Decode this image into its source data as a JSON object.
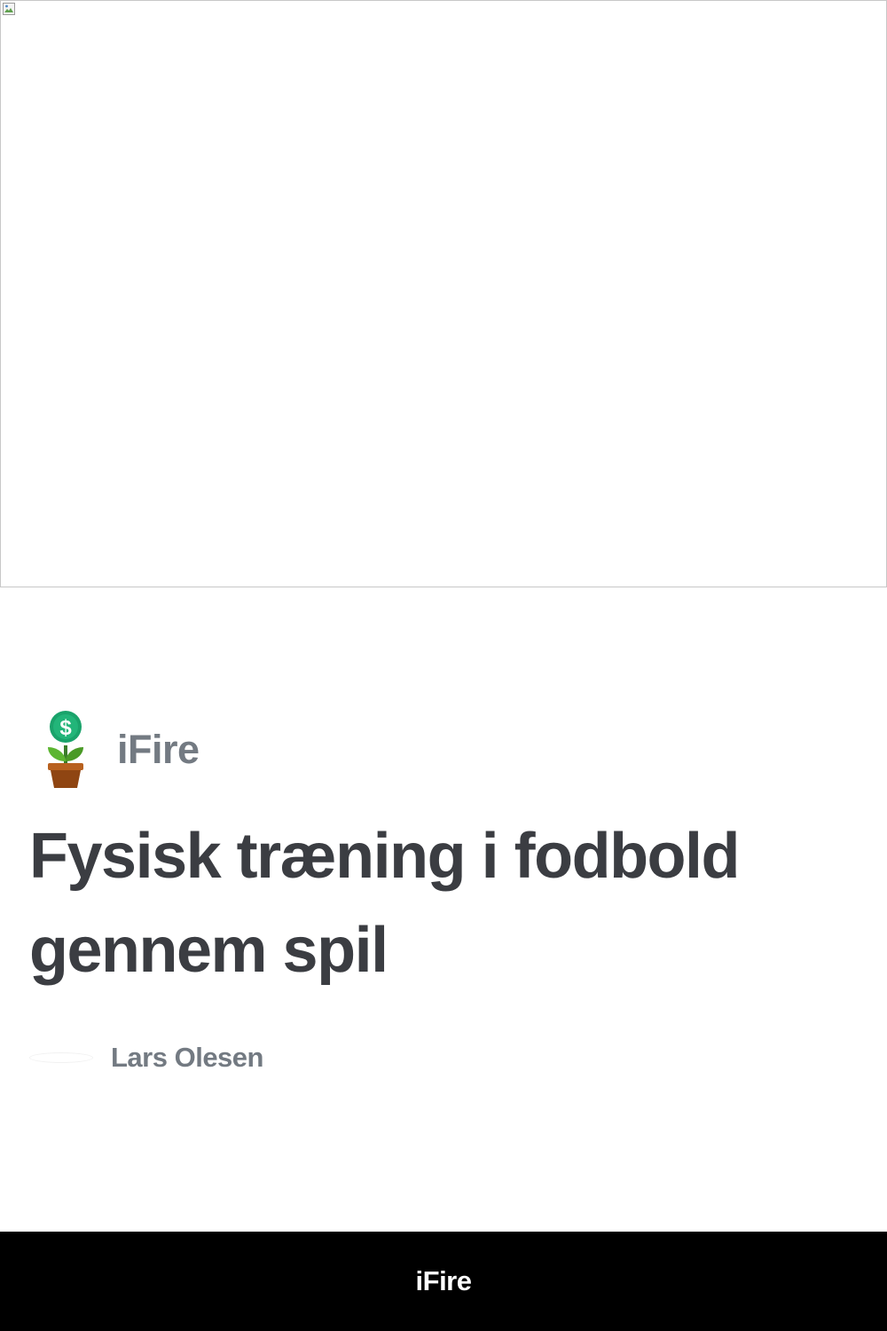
{
  "hero": {
    "icon": "broken-image-icon"
  },
  "brand": {
    "logo_icon": "money-plant-icon",
    "name": "iFire"
  },
  "story": {
    "title": "Fysisk træning i fodbold gennem spil"
  },
  "author": {
    "name": "Lars Olesen"
  },
  "footer": {
    "label": "iFire"
  },
  "colors": {
    "title_text": "#3b3d42",
    "muted_text": "#737a82",
    "footer_background": "#000000",
    "coin_green": "#1aa36b",
    "leaf_green": "#5cb531",
    "pot_brown": "#a3521a"
  }
}
